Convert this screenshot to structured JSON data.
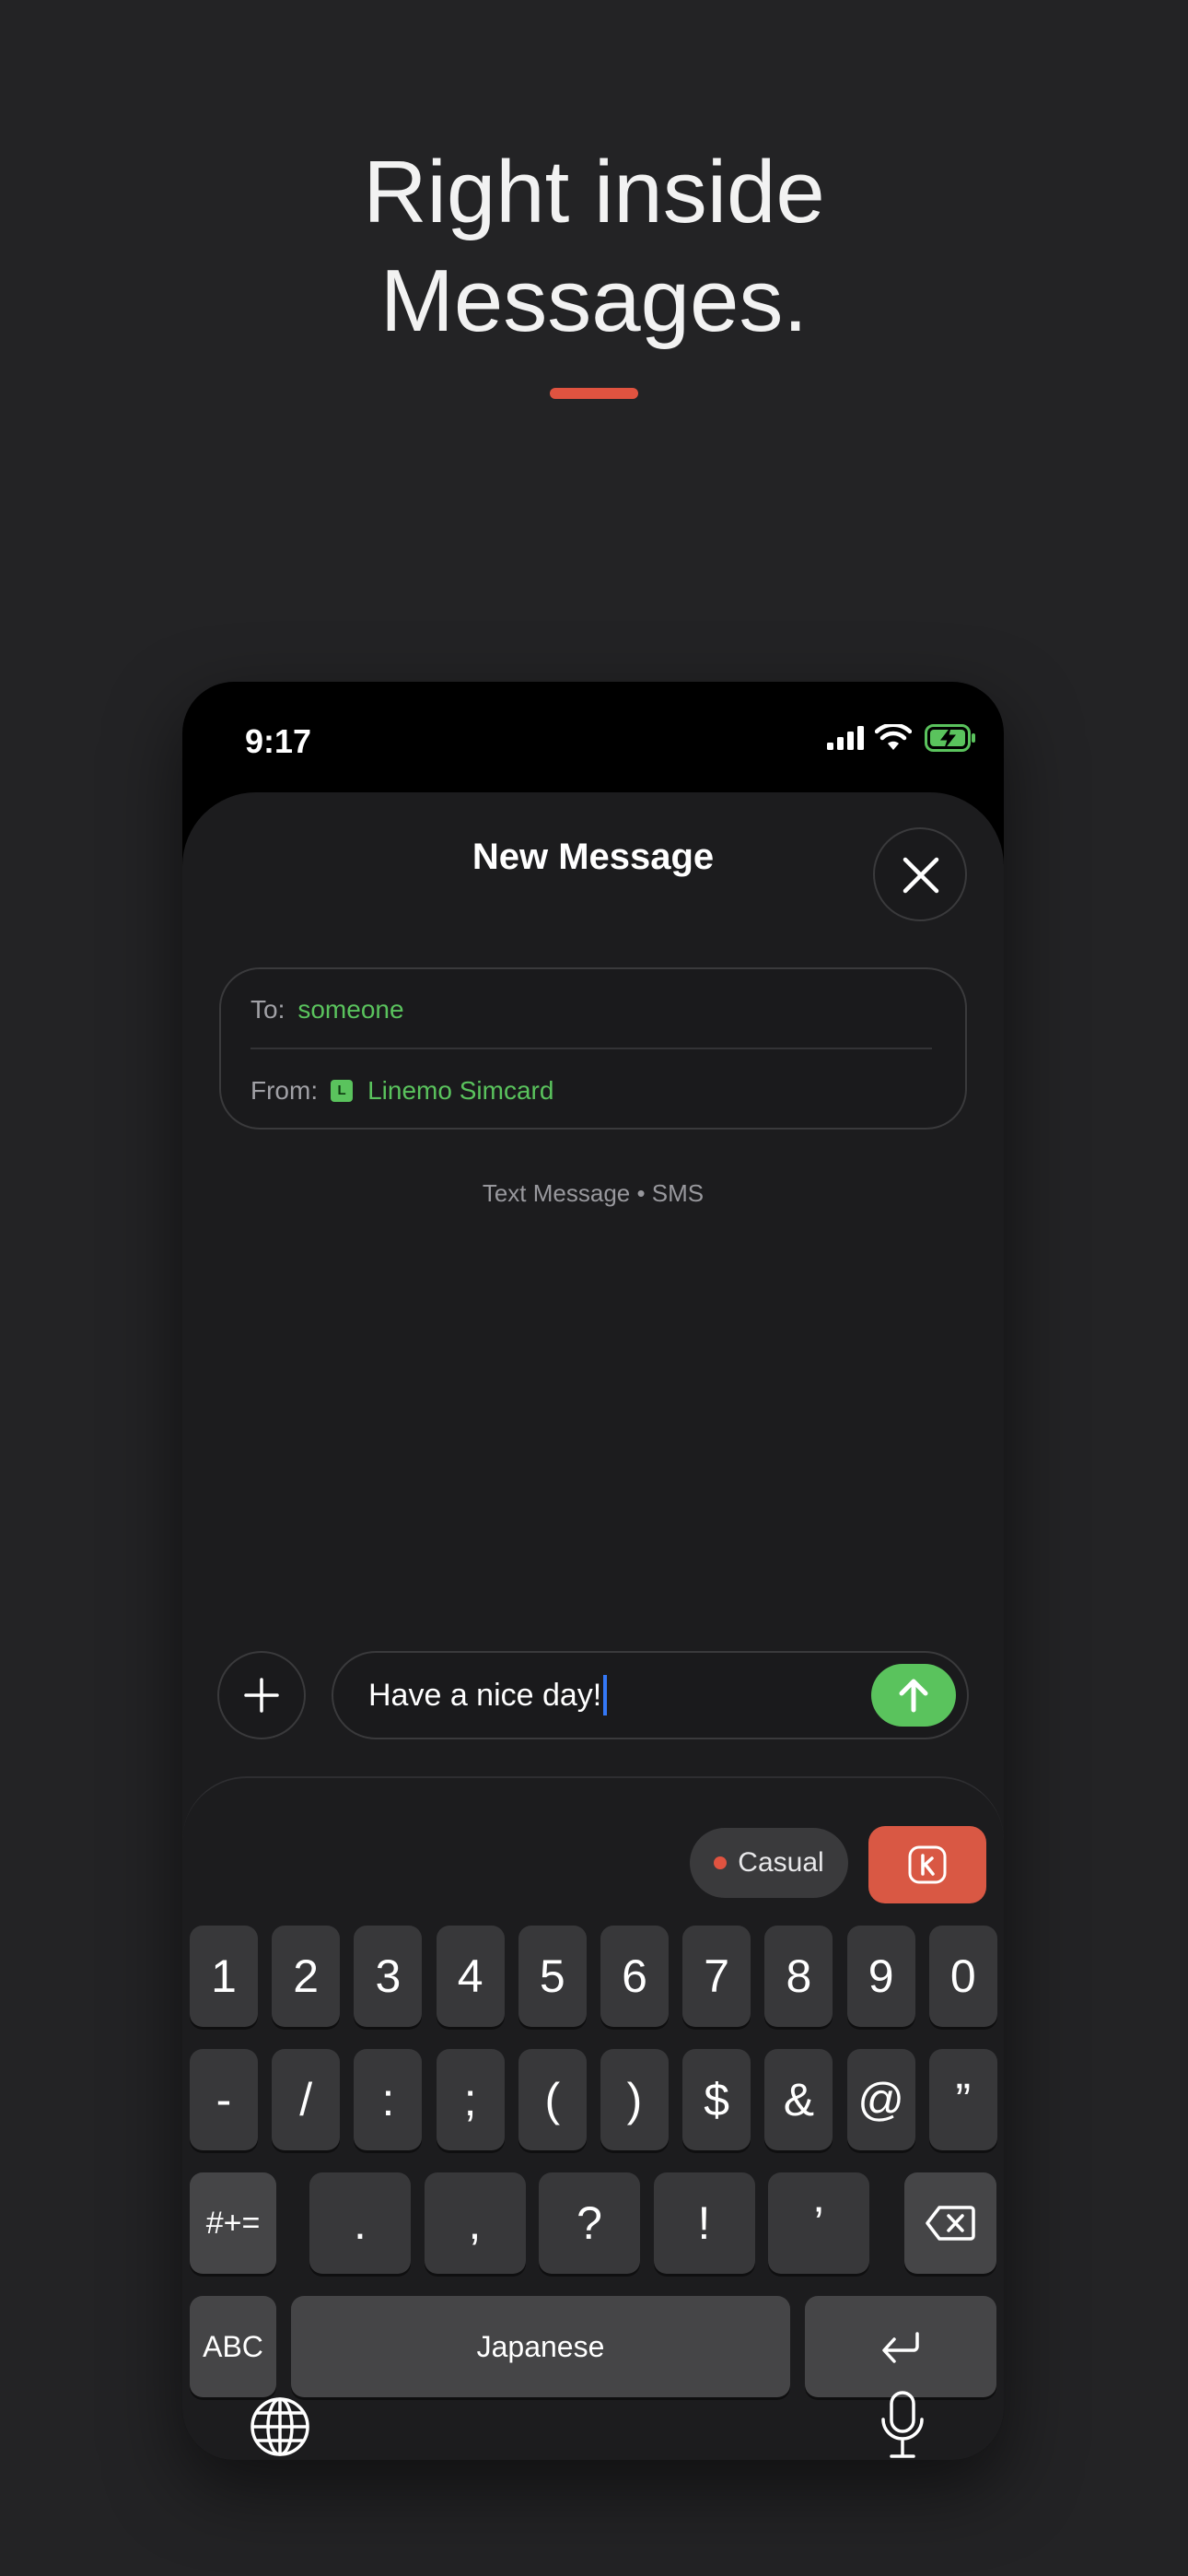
{
  "headline": {
    "line1": "Right inside",
    "line2": "Messages."
  },
  "colors": {
    "accent": "#e05340",
    "green": "#5ac35d",
    "background": "#232325"
  },
  "status_bar": {
    "time": "9:17"
  },
  "sheet": {
    "title": "New Message",
    "close_icon": "close-icon",
    "to_label": "To:",
    "to_value": "someone",
    "from_label": "From:",
    "sim_badge": "L",
    "from_value": "Linemo Simcard",
    "caption": "Text Message • SMS"
  },
  "composer": {
    "text": "Have a nice day!",
    "plus_icon": "plus-icon",
    "send_icon": "arrow-up-icon"
  },
  "keyboard": {
    "tone_label": "Casual",
    "row1": [
      "1",
      "2",
      "3",
      "4",
      "5",
      "6",
      "7",
      "8",
      "9",
      "0"
    ],
    "row2": [
      "-",
      "/",
      ":",
      ";",
      "(",
      ")",
      "$",
      "&",
      "@",
      "”"
    ],
    "row3": [
      ".",
      ",",
      "?",
      "!",
      "’"
    ],
    "shift_label": "#+=",
    "abc_label": "ABC",
    "space_label": "Japanese",
    "delete_icon": "delete-icon",
    "return_icon": "return-icon",
    "globe_icon": "globe-icon",
    "mic_icon": "microphone-icon"
  }
}
